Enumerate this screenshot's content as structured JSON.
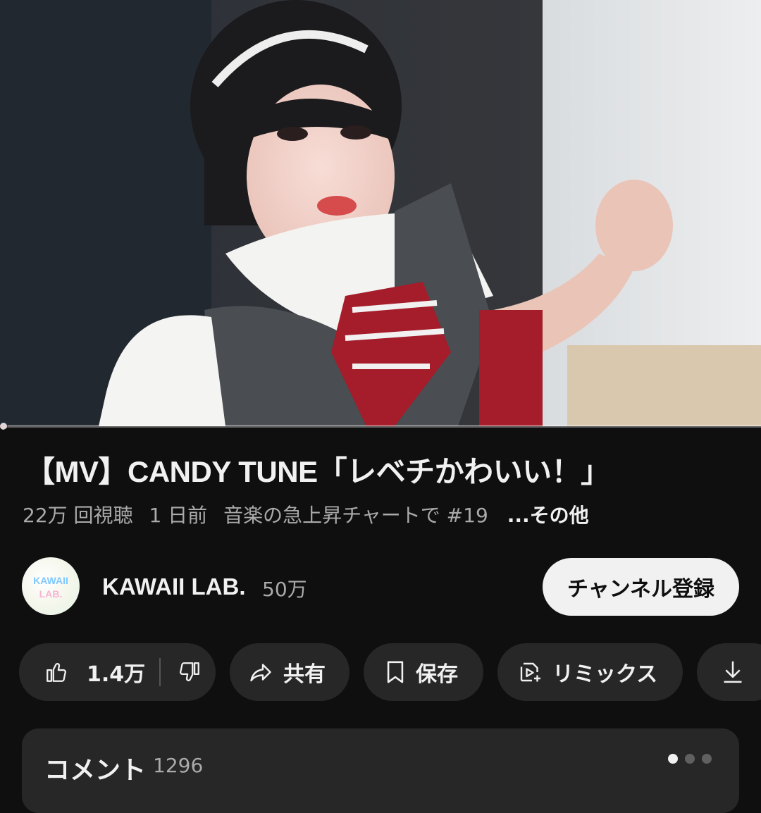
{
  "video": {
    "progress_fraction": 0.01
  },
  "title": "【MV】CANDY TUNE「レベチかわいい！」",
  "meta": {
    "views": "22万 回視聴",
    "age": "1 日前",
    "chart": "音楽の急上昇チャートで #19",
    "more": "...その他"
  },
  "channel": {
    "name": "KAWAII LAB.",
    "subscribers": "50万",
    "avatar_text_top": "KAWAII",
    "avatar_text_bottom": "LAB.",
    "subscribe_label": "チャンネル登録"
  },
  "actions": {
    "like_count": "1.4万",
    "share_label": "共有",
    "save_label": "保存",
    "remix_label": "リミックス",
    "like_icon": "thumbs-up-icon",
    "dislike_icon": "thumbs-down-icon",
    "share_icon": "share-arrow-icon",
    "save_icon": "bookmark-icon",
    "remix_icon": "remix-icon",
    "download_icon": "download-icon"
  },
  "comments": {
    "title": "コメント",
    "count": "1296",
    "page_dots": 3,
    "active_dot": 0
  },
  "colors": {
    "background": "#0f0f0f",
    "chip": "#272727",
    "text_primary": "#f1f1f1",
    "text_secondary": "#aaaaaa",
    "subscribe_bg": "#f1f1f1"
  }
}
